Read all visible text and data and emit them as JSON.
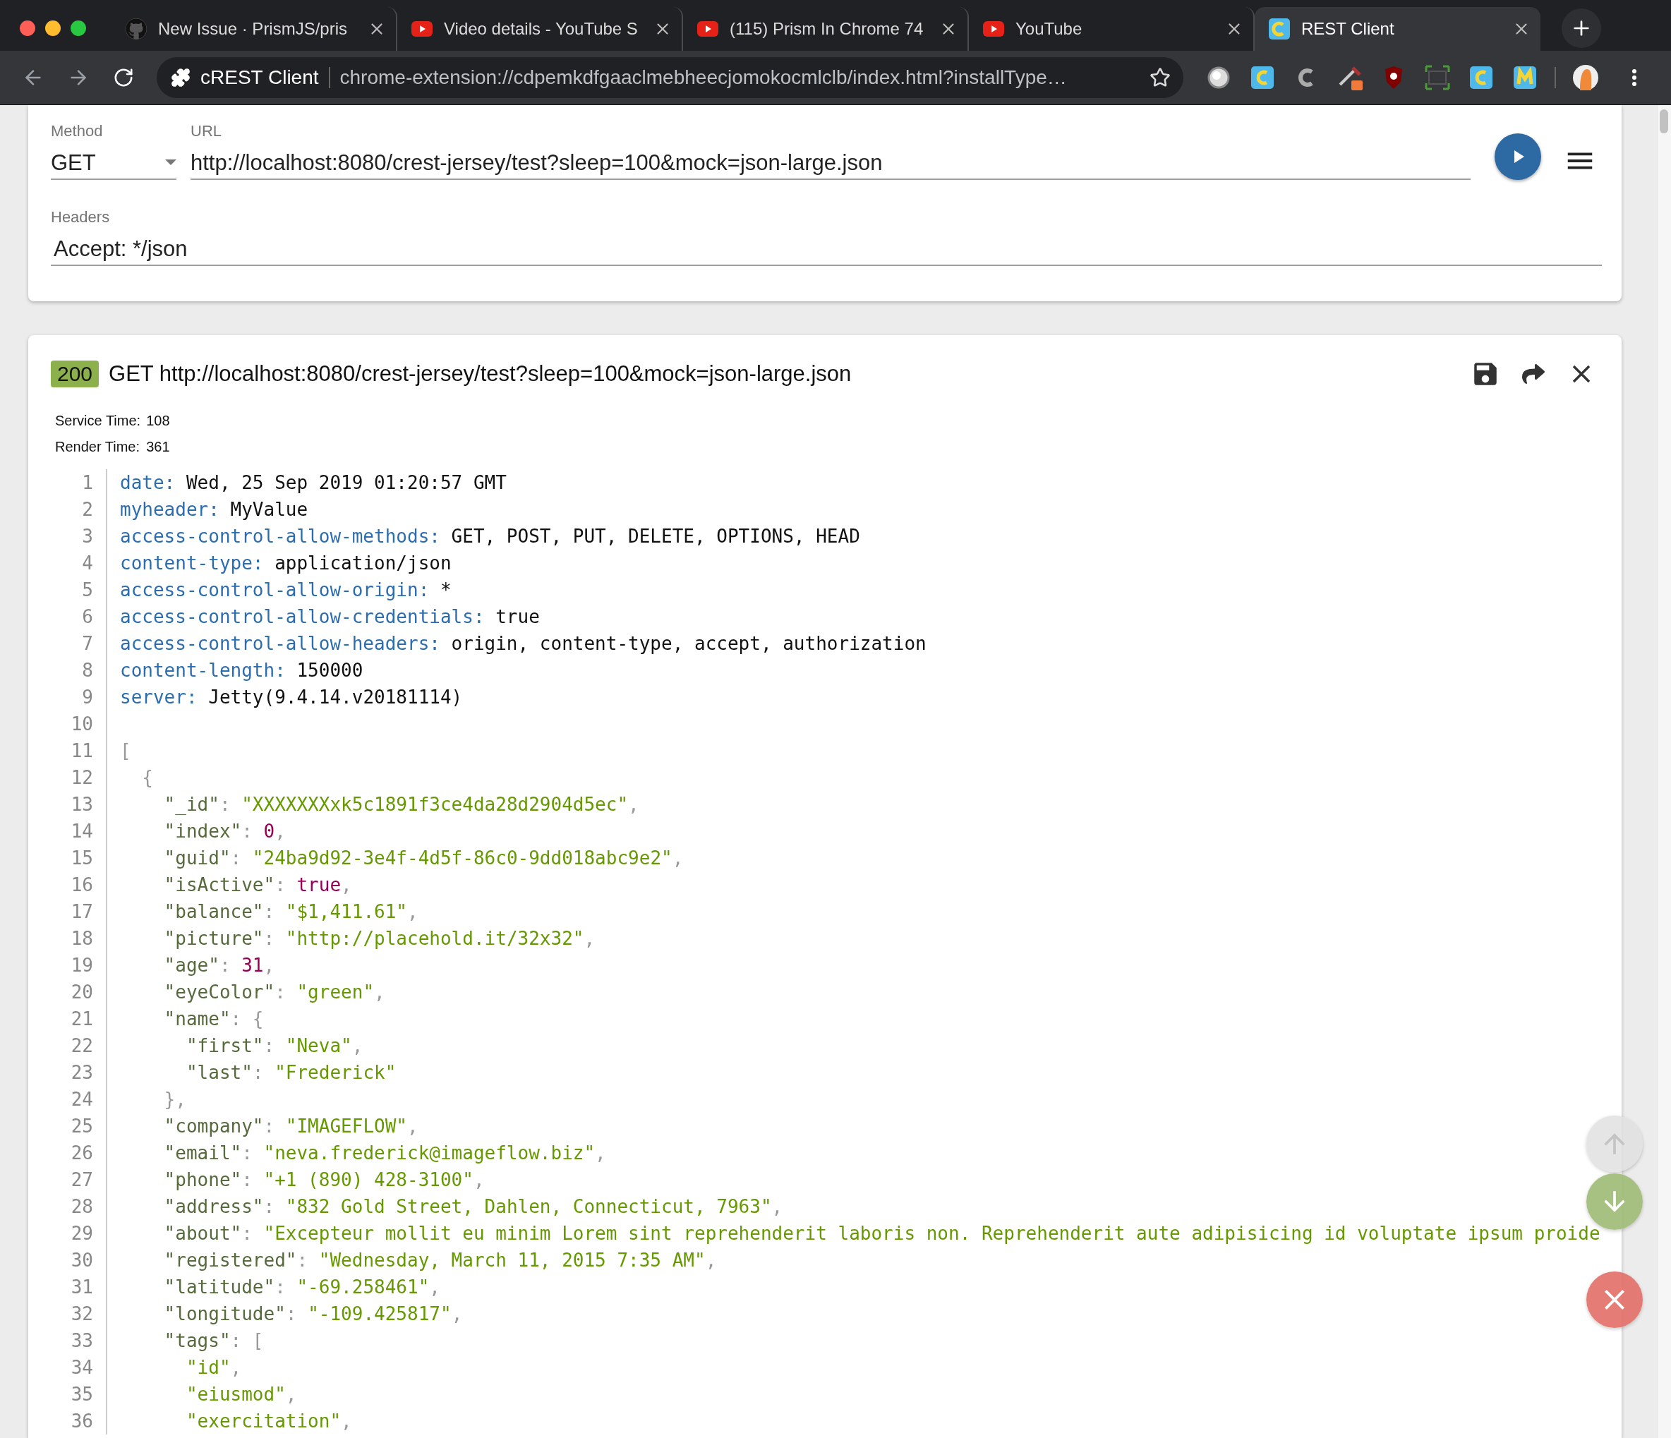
{
  "browser": {
    "tabs": [
      {
        "kind": "github",
        "title": "New Issue · PrismJS/pris",
        "selected": false
      },
      {
        "kind": "youtube",
        "title": "Video details - YouTube S",
        "selected": false
      },
      {
        "kind": "youtube",
        "title": "(115) Prism In Chrome 74",
        "selected": false
      },
      {
        "kind": "youtube",
        "title": "YouTube",
        "selected": false
      },
      {
        "kind": "crest",
        "title": "REST Client",
        "selected": true
      }
    ],
    "site_name": "cREST Client",
    "address": "chrome-extension://cdpemkdfgaaclmebheecjomokocmlclb/index.html?installType…"
  },
  "request": {
    "method": {
      "label": "Method",
      "value": "GET"
    },
    "url": {
      "label": "URL",
      "value": "http://localhost:8080/crest-jersey/test?sleep=100&mock=json-large.json"
    },
    "headers": {
      "label": "Headers",
      "value": "Accept: */json"
    }
  },
  "response": {
    "status": "200",
    "request_line": "GET http://localhost:8080/crest-jersey/test?sleep=100&mock=json-large.json",
    "timings": [
      {
        "label": "Service Time:",
        "value": "108"
      },
      {
        "label": "Render Time:",
        "value": "361"
      }
    ],
    "lines": [
      {
        "number": "1",
        "tokens": [
          {
            "kind": "header",
            "text": "date:"
          },
          {
            "kind": "text",
            "text": " Wed, 25 Sep 2019 01:20:57 GMT"
          }
        ]
      },
      {
        "number": "2",
        "tokens": [
          {
            "kind": "header",
            "text": "myheader:"
          },
          {
            "kind": "text",
            "text": " MyValue"
          }
        ]
      },
      {
        "number": "3",
        "tokens": [
          {
            "kind": "header",
            "text": "access-control-allow-methods:"
          },
          {
            "kind": "text",
            "text": " GET, POST, PUT, DELETE, OPTIONS, HEAD"
          }
        ]
      },
      {
        "number": "4",
        "tokens": [
          {
            "kind": "header",
            "text": "content-type:"
          },
          {
            "kind": "text",
            "text": " application/json"
          }
        ]
      },
      {
        "number": "5",
        "tokens": [
          {
            "kind": "header",
            "text": "access-control-allow-origin:"
          },
          {
            "kind": "text",
            "text": " *"
          }
        ]
      },
      {
        "number": "6",
        "tokens": [
          {
            "kind": "header",
            "text": "access-control-allow-credentials:"
          },
          {
            "kind": "text",
            "text": " true"
          }
        ]
      },
      {
        "number": "7",
        "tokens": [
          {
            "kind": "header",
            "text": "access-control-allow-headers:"
          },
          {
            "kind": "text",
            "text": " origin, content-type, accept, authorization"
          }
        ]
      },
      {
        "number": "8",
        "tokens": [
          {
            "kind": "header",
            "text": "content-length:"
          },
          {
            "kind": "text",
            "text": " 150000"
          }
        ]
      },
      {
        "number": "9",
        "tokens": [
          {
            "kind": "header",
            "text": "server:"
          },
          {
            "kind": "text",
            "text": " Jetty(9.4.14.v20181114)"
          }
        ]
      },
      {
        "number": "10"
      },
      {
        "number": "11",
        "tokens": [
          {
            "kind": "punct",
            "text": "["
          }
        ]
      },
      {
        "number": "12",
        "tokens": [
          {
            "kind": "punct",
            "text": "  {"
          }
        ]
      },
      {
        "number": "13",
        "tokens": [
          {
            "kind": "property",
            "text": "    \"_id\""
          },
          {
            "kind": "punct",
            "text": ": "
          },
          {
            "kind": "string",
            "text": "\"XXXXXXXxk5c1891f3ce4da28d2904d5ec\""
          },
          {
            "kind": "punct",
            "text": ","
          }
        ]
      },
      {
        "number": "14",
        "tokens": [
          {
            "kind": "property",
            "text": "    \"index\""
          },
          {
            "kind": "punct",
            "text": ": "
          },
          {
            "kind": "number",
            "text": "0"
          },
          {
            "kind": "punct",
            "text": ","
          }
        ]
      },
      {
        "number": "15",
        "tokens": [
          {
            "kind": "property",
            "text": "    \"guid\""
          },
          {
            "kind": "punct",
            "text": ": "
          },
          {
            "kind": "string",
            "text": "\"24ba9d92-3e4f-4d5f-86c0-9dd018abc9e2\""
          },
          {
            "kind": "punct",
            "text": ","
          }
        ]
      },
      {
        "number": "16",
        "tokens": [
          {
            "kind": "property",
            "text": "    \"isActive\""
          },
          {
            "kind": "punct",
            "text": ": "
          },
          {
            "kind": "number",
            "text": "true"
          },
          {
            "kind": "punct",
            "text": ","
          }
        ]
      },
      {
        "number": "17",
        "tokens": [
          {
            "kind": "property",
            "text": "    \"balance\""
          },
          {
            "kind": "punct",
            "text": ": "
          },
          {
            "kind": "string",
            "text": "\"$1,411.61\""
          },
          {
            "kind": "punct",
            "text": ","
          }
        ]
      },
      {
        "number": "18",
        "tokens": [
          {
            "kind": "property",
            "text": "    \"picture\""
          },
          {
            "kind": "punct",
            "text": ": "
          },
          {
            "kind": "string",
            "text": "\"http://placehold.it/32x32\""
          },
          {
            "kind": "punct",
            "text": ","
          }
        ]
      },
      {
        "number": "19",
        "tokens": [
          {
            "kind": "property",
            "text": "    \"age\""
          },
          {
            "kind": "punct",
            "text": ": "
          },
          {
            "kind": "number",
            "text": "31"
          },
          {
            "kind": "punct",
            "text": ","
          }
        ]
      },
      {
        "number": "20",
        "tokens": [
          {
            "kind": "property",
            "text": "    \"eyeColor\""
          },
          {
            "kind": "punct",
            "text": ": "
          },
          {
            "kind": "string",
            "text": "\"green\""
          },
          {
            "kind": "punct",
            "text": ","
          }
        ]
      },
      {
        "number": "21",
        "tokens": [
          {
            "kind": "property",
            "text": "    \"name\""
          },
          {
            "kind": "punct",
            "text": ": {"
          }
        ]
      },
      {
        "number": "22",
        "tokens": [
          {
            "kind": "property",
            "text": "      \"first\""
          },
          {
            "kind": "punct",
            "text": ": "
          },
          {
            "kind": "string",
            "text": "\"Neva\""
          },
          {
            "kind": "punct",
            "text": ","
          }
        ]
      },
      {
        "number": "23",
        "tokens": [
          {
            "kind": "property",
            "text": "      \"last\""
          },
          {
            "kind": "punct",
            "text": ": "
          },
          {
            "kind": "string",
            "text": "\"Frederick\""
          }
        ]
      },
      {
        "number": "24",
        "tokens": [
          {
            "kind": "punct",
            "text": "    },"
          }
        ]
      },
      {
        "number": "25",
        "tokens": [
          {
            "kind": "property",
            "text": "    \"company\""
          },
          {
            "kind": "punct",
            "text": ": "
          },
          {
            "kind": "string",
            "text": "\"IMAGEFLOW\""
          },
          {
            "kind": "punct",
            "text": ","
          }
        ]
      },
      {
        "number": "26",
        "tokens": [
          {
            "kind": "property",
            "text": "    \"email\""
          },
          {
            "kind": "punct",
            "text": ": "
          },
          {
            "kind": "string",
            "text": "\"neva.frederick@imageflow.biz\""
          },
          {
            "kind": "punct",
            "text": ","
          }
        ]
      },
      {
        "number": "27",
        "tokens": [
          {
            "kind": "property",
            "text": "    \"phone\""
          },
          {
            "kind": "punct",
            "text": ": "
          },
          {
            "kind": "string",
            "text": "\"+1 (890) 428-3100\""
          },
          {
            "kind": "punct",
            "text": ","
          }
        ]
      },
      {
        "number": "28",
        "tokens": [
          {
            "kind": "property",
            "text": "    \"address\""
          },
          {
            "kind": "punct",
            "text": ": "
          },
          {
            "kind": "string",
            "text": "\"832 Gold Street, Dahlen, Connecticut, 7963\""
          },
          {
            "kind": "punct",
            "text": ","
          }
        ]
      },
      {
        "number": "29",
        "tokens": [
          {
            "kind": "property",
            "text": "    \"about\""
          },
          {
            "kind": "punct",
            "text": ": "
          },
          {
            "kind": "string",
            "text": "\"Excepteur mollit eu minim Lorem sint reprehenderit laboris non. Reprehenderit aute adipisicing id voluptate ipsum proide"
          }
        ]
      },
      {
        "number": "30",
        "tokens": [
          {
            "kind": "property",
            "text": "    \"registered\""
          },
          {
            "kind": "punct",
            "text": ": "
          },
          {
            "kind": "string",
            "text": "\"Wednesday, March 11, 2015 7:35 AM\""
          },
          {
            "kind": "punct",
            "text": ","
          }
        ]
      },
      {
        "number": "31",
        "tokens": [
          {
            "kind": "property",
            "text": "    \"latitude\""
          },
          {
            "kind": "punct",
            "text": ": "
          },
          {
            "kind": "string",
            "text": "\"-69.258461\""
          },
          {
            "kind": "punct",
            "text": ","
          }
        ]
      },
      {
        "number": "32",
        "tokens": [
          {
            "kind": "property",
            "text": "    \"longitude\""
          },
          {
            "kind": "punct",
            "text": ": "
          },
          {
            "kind": "string",
            "text": "\"-109.425817\""
          },
          {
            "kind": "punct",
            "text": ","
          }
        ]
      },
      {
        "number": "33",
        "tokens": [
          {
            "kind": "property",
            "text": "    \"tags\""
          },
          {
            "kind": "punct",
            "text": ": ["
          }
        ]
      },
      {
        "number": "34",
        "tokens": [
          {
            "kind": "string",
            "text": "      \"id\""
          },
          {
            "kind": "punct",
            "text": ","
          }
        ]
      },
      {
        "number": "35",
        "tokens": [
          {
            "kind": "string",
            "text": "      \"eiusmod\""
          },
          {
            "kind": "punct",
            "text": ","
          }
        ]
      },
      {
        "number": "36",
        "tokens": [
          {
            "kind": "string",
            "text": "      \"exercitation\""
          },
          {
            "kind": "punct",
            "text": ","
          }
        ]
      }
    ],
    "scroll_up": {
      "disabled": true
    }
  }
}
